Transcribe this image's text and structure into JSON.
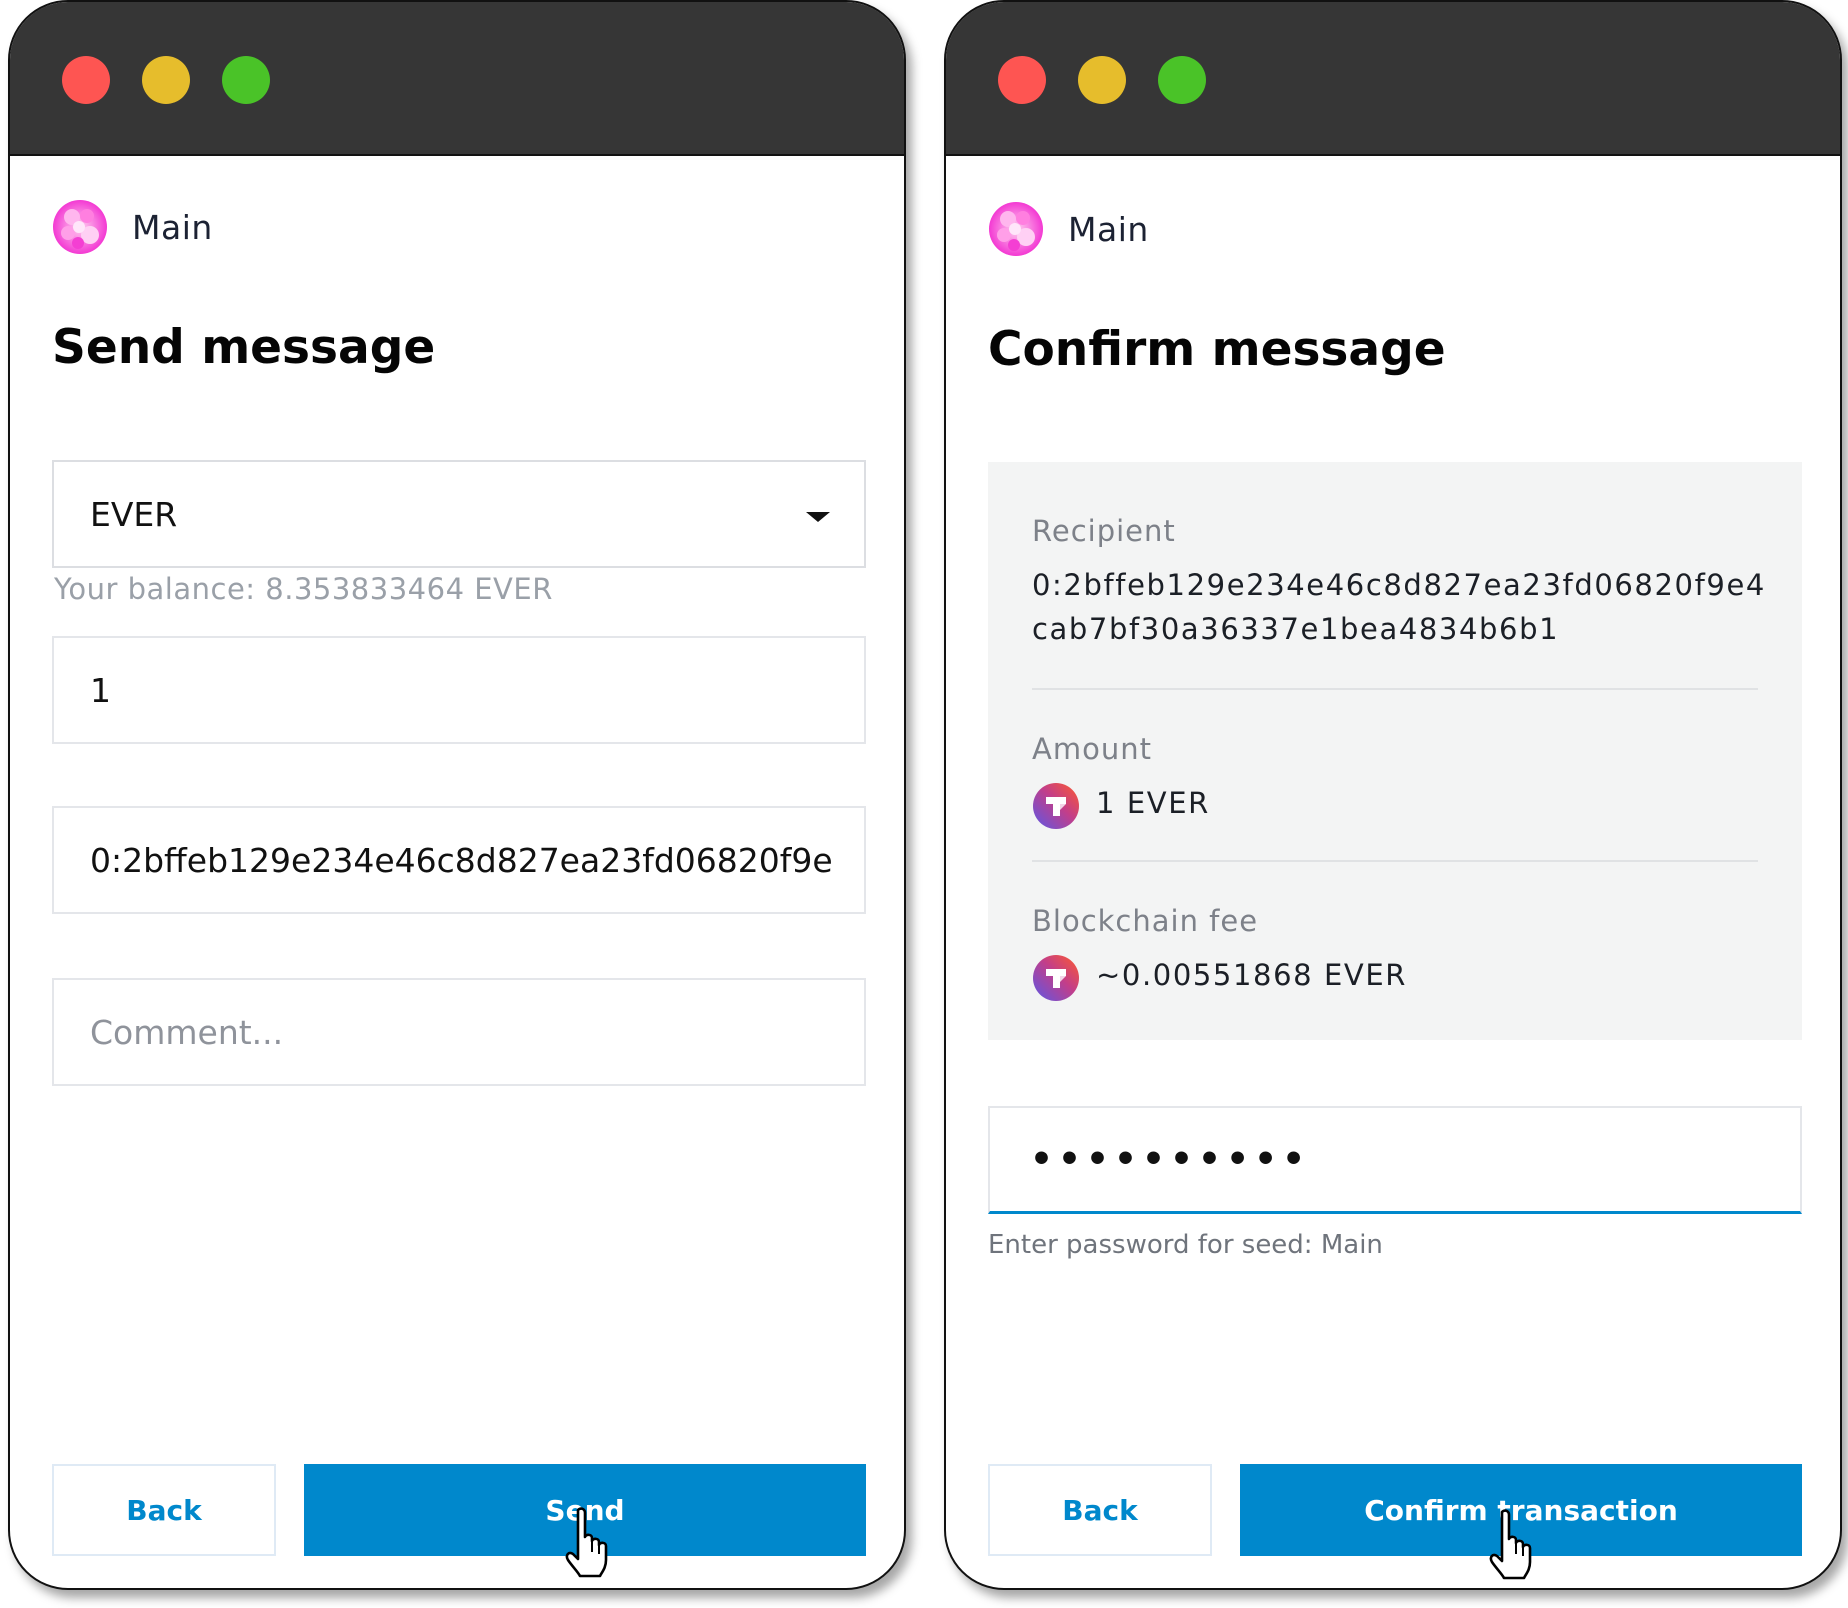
{
  "send_screen": {
    "account_name": "Main",
    "title": "Send message",
    "token_select": "EVER",
    "balance_text": "Your balance: 8.353833464 EVER",
    "amount_value": "1",
    "address_value": "0:2bffeb129e234e46c8d827ea23fd06820f9e",
    "comment_placeholder": "Comment...",
    "back_label": "Back",
    "send_label": "Send"
  },
  "confirm_screen": {
    "account_name": "Main",
    "title": "Confirm message",
    "recipient_label": "Recipient",
    "recipient_line1": "0:2bffeb129e234e46c8d827ea23fd06820f9e4",
    "recipient_line2": "cab7bf30a36337e1bea4834b6b1",
    "amount_label": "Amount",
    "amount_value": "1 EVER",
    "fee_label": "Blockchain fee",
    "fee_value": "~0.00551868 EVER",
    "password_mask": "••••••••••",
    "password_hint": "Enter password for seed: Main",
    "back_label": "Back",
    "confirm_label": "Confirm transaction"
  },
  "colors": {
    "accent": "#0088cc",
    "titlebar": "#363636",
    "traffic_red": "#fe5552",
    "traffic_yellow": "#e6bd2c",
    "traffic_green": "#4ac328"
  },
  "icons": {
    "avatar": "avatar-icon",
    "token": "ever-token-icon",
    "cursor": "hand-pointer-icon",
    "dropdown": "chevron-down-icon"
  }
}
